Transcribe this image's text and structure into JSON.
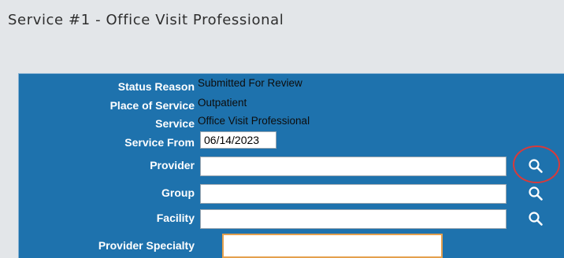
{
  "window": {
    "title": "Service #1 - Office Visit Professional"
  },
  "fields": {
    "status_reason": {
      "label": "Status Reason",
      "value": "Submitted For Review"
    },
    "place_of_service": {
      "label": "Place of Service",
      "value": "Outpatient"
    },
    "service": {
      "label": "Service",
      "value": "Office Visit Professional"
    },
    "service_from": {
      "label": "Service From",
      "value": "06/14/2023"
    },
    "provider": {
      "label": "Provider",
      "value": ""
    },
    "group": {
      "label": "Group",
      "value": ""
    },
    "facility": {
      "label": "Facility",
      "value": ""
    },
    "provider_specialty": {
      "label": "Provider Specialty",
      "value": ""
    }
  },
  "icons": {
    "search": "magnifying-glass"
  },
  "colors": {
    "panel_background": "#1e72ad",
    "label_text": "#ffffff",
    "specialty_border": "#e4a04e",
    "highlight_ring": "#d93a3a"
  }
}
